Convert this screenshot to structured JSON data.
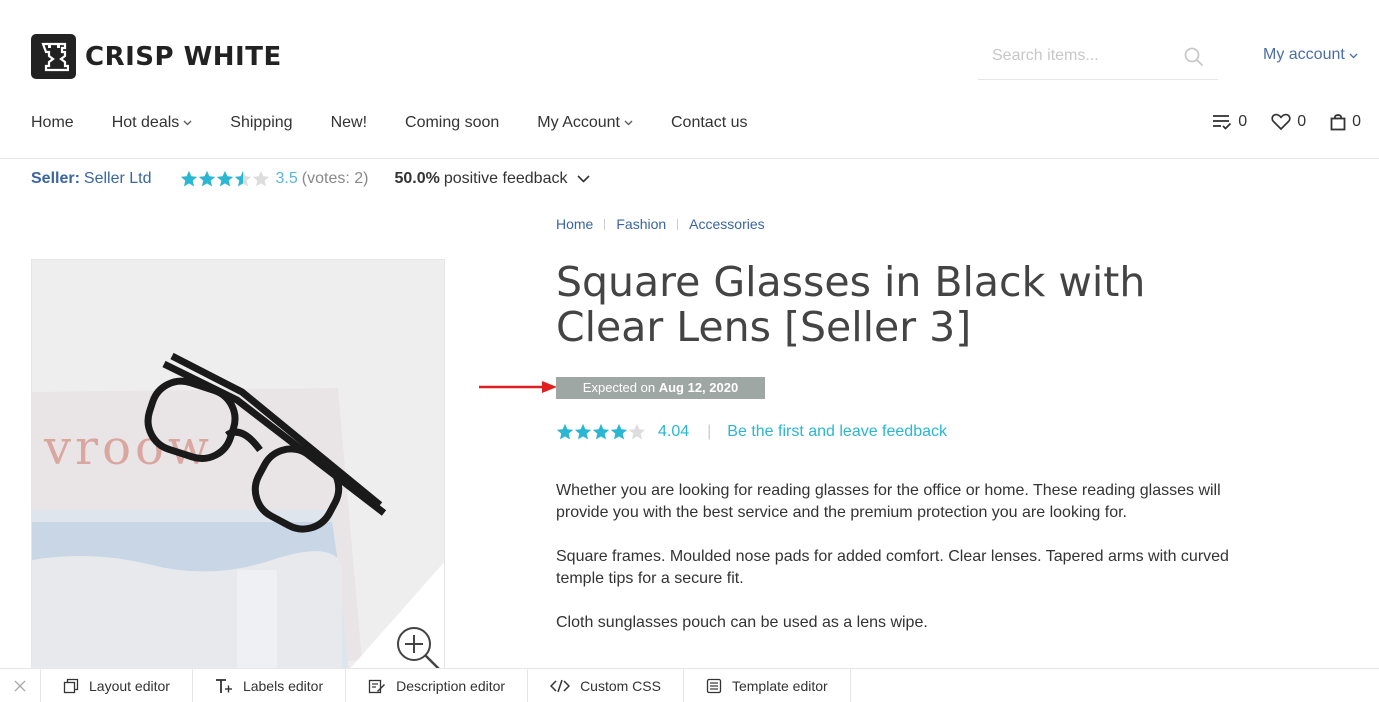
{
  "brand": {
    "name": "CRISP WHITE"
  },
  "search": {
    "placeholder": "Search items..."
  },
  "header": {
    "my_account": "My account"
  },
  "nav": {
    "items": [
      {
        "label": "Home",
        "dropdown": false
      },
      {
        "label": "Hot deals",
        "dropdown": true
      },
      {
        "label": "Shipping",
        "dropdown": false
      },
      {
        "label": "New!",
        "dropdown": false
      },
      {
        "label": "Coming soon",
        "dropdown": false
      },
      {
        "label": "My Account",
        "dropdown": true
      },
      {
        "label": "Contact us",
        "dropdown": false
      }
    ],
    "compare_count": "0",
    "wishlist_count": "0",
    "cart_count": "0"
  },
  "seller": {
    "label": "Seller:",
    "name": "Seller Ltd",
    "rating": "3.5",
    "rating_value": 3.5,
    "votes": "(votes: 2)",
    "positive_pct": "50.0%",
    "positive_label": "positive feedback"
  },
  "breadcrumb": [
    "Home",
    "Fashion",
    "Accessories"
  ],
  "product": {
    "title": "Square Glasses in Black with Clear Lens [Seller 3]",
    "expected_prefix": "Expected on",
    "expected_date": "Aug 12, 2020",
    "rating": "4.04",
    "rating_value": 4.04,
    "feedback_link": "Be the first and leave feedback",
    "image_text": "vroow",
    "description": [
      "Whether you are looking for reading glasses for the office or home. These reading glasses will provide you with the best service and the premium protection you are looking for.",
      "Square frames. Moulded nose pads for added comfort. Clear lenses. Tapered arms with curved temple tips for a secure fit.",
      "Cloth sunglasses pouch can be used as a lens wipe."
    ]
  },
  "toolbar": {
    "items": [
      {
        "label": "Layout editor",
        "icon": "layout-icon"
      },
      {
        "label": "Labels editor",
        "icon": "text-plus-icon"
      },
      {
        "label": "Description editor",
        "icon": "edit-document-icon"
      },
      {
        "label": "Custom CSS",
        "icon": "code-icon"
      },
      {
        "label": "Template editor",
        "icon": "template-icon"
      }
    ]
  },
  "colors": {
    "link_blue": "#3a65a1",
    "accent_cyan": "#29b7d3",
    "expected_badge": "#9ea7a3",
    "annotation_arrow": "#e02020"
  }
}
